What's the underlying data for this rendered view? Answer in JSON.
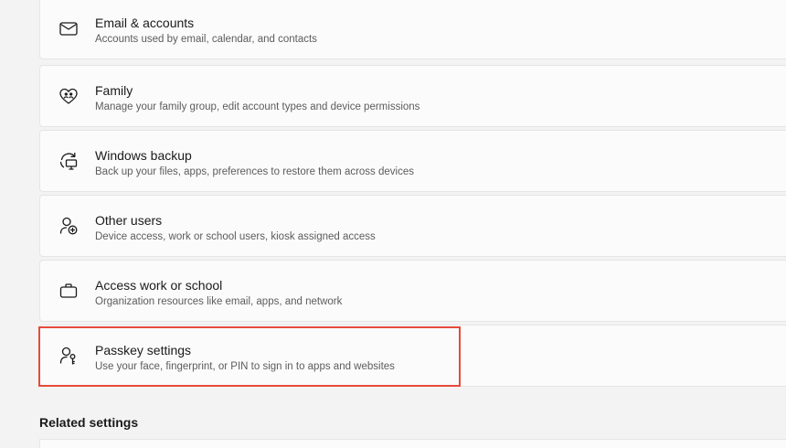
{
  "items": [
    {
      "icon": "mail-icon",
      "title": "Email & accounts",
      "description": "Accounts used by email, calendar, and contacts"
    },
    {
      "icon": "family-heart-icon",
      "title": "Family",
      "description": "Manage your family group, edit account types and device permissions"
    },
    {
      "icon": "windows-backup-icon",
      "title": "Windows backup",
      "description": "Back up your files, apps, preferences to restore them across devices"
    },
    {
      "icon": "add-user-icon",
      "title": "Other users",
      "description": "Device access, work or school users, kiosk assigned access"
    },
    {
      "icon": "briefcase-icon",
      "title": "Access work or school",
      "description": "Organization resources like email, apps, and network"
    },
    {
      "icon": "passkey-icon",
      "title": "Passkey settings",
      "description": "Use your face, fingerprint, or PIN to sign in to apps and websites",
      "highlighted": true
    }
  ],
  "related_settings_heading": "Related settings",
  "highlight_color": "#e74a3b"
}
